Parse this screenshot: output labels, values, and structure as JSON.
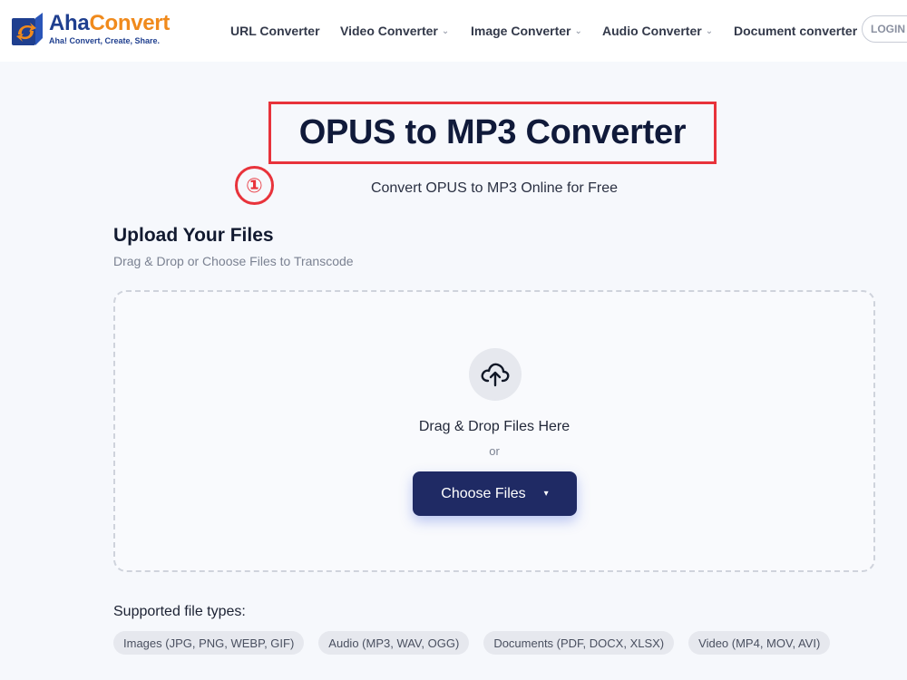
{
  "brand": {
    "name_part1": "Aha",
    "name_part2": "Convert",
    "tagline": "Aha! Convert, Create, Share.",
    "colors": {
      "primary": "#1f3f8f",
      "accent": "#f08a1c"
    }
  },
  "nav": {
    "items": [
      {
        "label": "URL Converter",
        "has_dropdown": false
      },
      {
        "label": "Video Converter",
        "has_dropdown": true
      },
      {
        "label": "Image Converter",
        "has_dropdown": true
      },
      {
        "label": "Audio Converter",
        "has_dropdown": true
      },
      {
        "label": "Document converter",
        "has_dropdown": false
      }
    ],
    "login_label": "LOGIN"
  },
  "hero": {
    "title": "OPUS to MP3 Converter",
    "subtitle": "Convert OPUS to MP3 Online for Free",
    "step_marker": "①",
    "highlight_color": "#e8333b"
  },
  "upload": {
    "heading": "Upload Your Files",
    "subheading": "Drag & Drop or Choose Files to Transcode",
    "icon": "cloud-upload-icon",
    "drop_text": "Drag & Drop Files Here",
    "or_text": "or",
    "choose_label": "Choose Files",
    "choose_caret": "▾",
    "button_color": "#1f2a64"
  },
  "supported": {
    "label": "Supported file types:",
    "types": [
      "Images (JPG, PNG, WEBP, GIF)",
      "Audio (MP3, WAV, OGG)",
      "Documents (PDF, DOCX, XLSX)",
      "Video (MP4, MOV, AVI)"
    ]
  }
}
